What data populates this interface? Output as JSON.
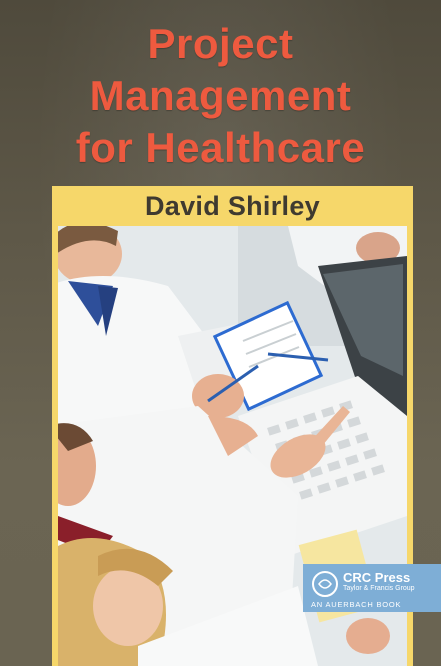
{
  "book": {
    "title_lines": [
      "Project",
      "Management",
      "for Healthcare"
    ],
    "author": "David Shirley"
  },
  "publisher": {
    "name": "CRC Press",
    "group": "Taylor & Francis Group",
    "imprint": "AN AUERBACH BOOK",
    "logo_icon": "crc-logo-icon"
  },
  "colors": {
    "background": "#5e5848",
    "title": "#ee5a3f",
    "author_band": "#f6d76a",
    "author_text": "#3f3a30",
    "publisher_badge": "#7eaed6"
  }
}
